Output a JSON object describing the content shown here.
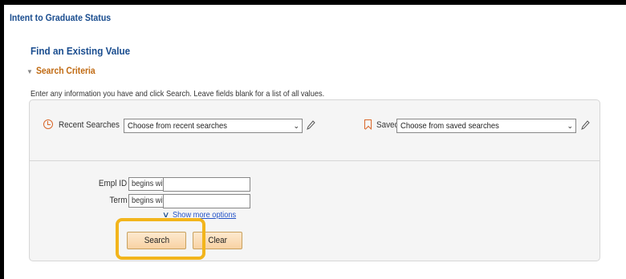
{
  "header": {
    "page_title": "Intent to Graduate Status",
    "find_title": "Find an Existing Value"
  },
  "criteria": {
    "toggle_label": "Search Criteria",
    "instructions": "Enter any information you have and click Search. Leave fields blank for a list of all values."
  },
  "recent": {
    "label": "Recent Searches",
    "selected": "Choose from recent searches"
  },
  "saved": {
    "label": "Saved Searches",
    "selected": "Choose from saved searches"
  },
  "fields": [
    {
      "label": "Empl ID",
      "operator": "begins with",
      "value": ""
    },
    {
      "label": "Term",
      "operator": "begins with",
      "value": ""
    }
  ],
  "more_options": "Show more options",
  "buttons": {
    "search": "Search",
    "clear": "Clear"
  },
  "highlight_color": "#f2b51c",
  "icons": {
    "recent": "history-icon",
    "saved": "bookmark-icon",
    "edit": "pencil-icon",
    "dropdown": "chevron-down-icon"
  }
}
